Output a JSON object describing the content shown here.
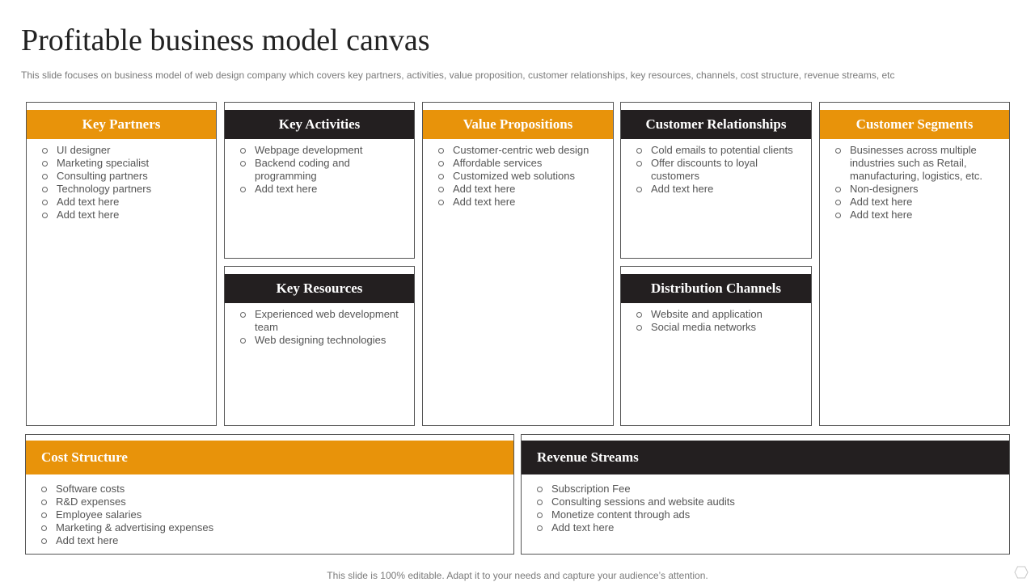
{
  "slide": {
    "title": "Profitable business model canvas",
    "subtitle": "This slide focuses on business model of web design company which covers key partners, activities, value proposition, customer relationships, key resources, channels, cost structure, revenue streams, etc",
    "footer": "This slide is 100% editable. Adapt it to your needs and capture your audience’s attention."
  },
  "colors": {
    "accent": "#e8930a",
    "dark": "#231f20",
    "border": "#555555"
  },
  "blocks": {
    "key_partners": {
      "heading": "Key Partners",
      "items": [
        "UI designer",
        "Marketing specialist",
        "Consulting partners",
        "Technology partners",
        "Add text here",
        "Add text here"
      ]
    },
    "key_activities": {
      "heading": "Key Activities",
      "items": [
        "Webpage development",
        "Backend coding and programming",
        "Add text here"
      ]
    },
    "value_propositions": {
      "heading": "Value Propositions",
      "items": [
        "Customer-centric web design",
        "Affordable  services",
        "Customized web solutions",
        "Add text here",
        "Add text here"
      ]
    },
    "customer_relationships": {
      "heading": "Customer Relationships",
      "items": [
        "Cold emails to potential clients",
        "Offer discounts to loyal customers",
        "Add text here"
      ]
    },
    "customer_segments": {
      "heading": "Customer Segments",
      "items": [
        "Businesses across multiple industries such as Retail, manufacturing, logistics, etc.",
        "Non-designers",
        "Add text here",
        "Add text here"
      ]
    },
    "key_resources": {
      "heading": "Key Resources",
      "items": [
        "Experienced web development  team",
        "Web designing technologies"
      ]
    },
    "distribution_channels": {
      "heading": "Distribution Channels",
      "items": [
        "Website and application",
        "Social media networks"
      ]
    },
    "cost_structure": {
      "heading": "Cost Structure",
      "items": [
        "Software costs",
        "R&D expenses",
        "Employee salaries",
        "Marketing & advertising  expenses",
        "Add text here"
      ]
    },
    "revenue_streams": {
      "heading": "Revenue Streams",
      "items": [
        "Subscription Fee",
        "Consulting sessions and website audits",
        "Monetize content through ads",
        "Add text here"
      ]
    }
  }
}
